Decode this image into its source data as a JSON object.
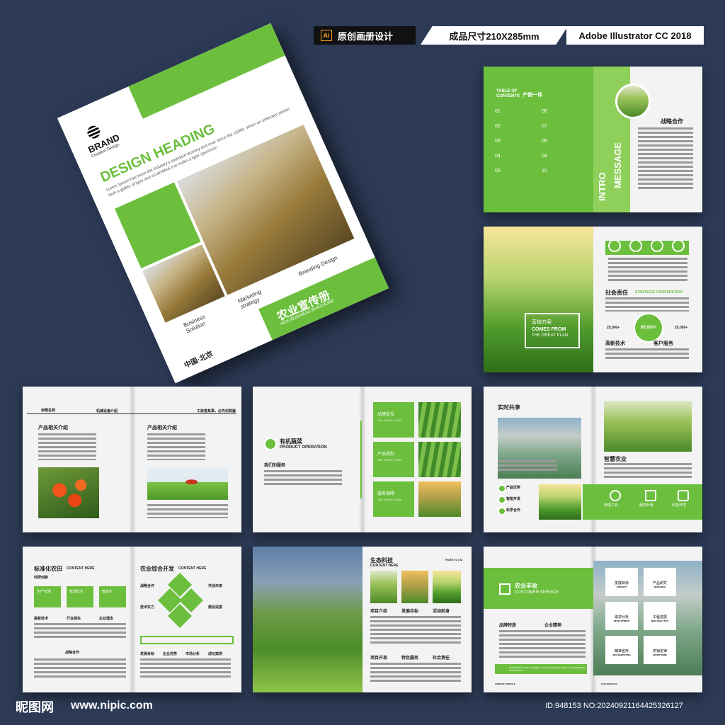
{
  "badges": {
    "ai_glyph": "Ai",
    "left": "原创画册设计",
    "mid": "成品尺寸210X285mm",
    "right": "Adobe Illustrator CC 2018"
  },
  "cover": {
    "brand": "BRAND",
    "brand_sub": "Creative Design",
    "heading": "DESIGN HEADING",
    "lorem": "Lorem Ipsum has been the industry's standard dummy text ever since the 1500s, when an unknown printer took a galley of type and scrambled it to make a type specimen",
    "item1": "Business Solution",
    "item2": "Marketing strategy",
    "item3": "Branding Design",
    "title_cn": "农业宣传册",
    "title_en": "NEW BUSINESS BORCHURE",
    "location": "中国·北京"
  },
  "p1": {
    "toc_a": "TABLE OF",
    "toc_b": "CONTENTS",
    "toc_cn": "产销一体",
    "nums_left": [
      "01",
      "02",
      "03",
      "04",
      "05"
    ],
    "nums_right": [
      "06",
      "07",
      "08",
      "09",
      "10"
    ],
    "intro": "INTRO",
    "message": "MESSAGE",
    "heading_cn": "战略合作"
  },
  "p2": {
    "social": "社会责任",
    "strategic": "STRATEGIC COOPERATION",
    "hl_cn": "营销方案",
    "hl1": "COMES FROM",
    "hl2": "THE GREAT PLAN",
    "stat": "85,000+",
    "stat_side1": "25,000+",
    "stat_side2": "25,000+",
    "lbl1": "高新技术",
    "lbl2": "客户服务"
  },
  "p3": {
    "top_label": "标题名称",
    "top_center": "机械设备介绍",
    "top_right": "工欲善其事，必先利其器",
    "col1": "产品相关介绍",
    "col2": "产品相关介绍"
  },
  "p4": {
    "cn": "有机蔬菜",
    "en": "PRODUCT OPERATION",
    "service": "我们的服务",
    "tab1": "品牌定位",
    "tab2": "产品规划",
    "tab3": "服务保障",
    "tab_sub": "Title of Work | Date"
  },
  "p5": {
    "title": "实时共享",
    "smart": "智慧农业",
    "items": [
      "产品优势",
      "智能开发",
      "科学合作"
    ],
    "icons": [
      "管理工具",
      "服务升级",
      "科技开发"
    ]
  },
  "p6": {
    "left_title": "标准化农田",
    "left_en": "CONTENT HERE",
    "left_sub": "科研创新",
    "bubbles": [
      "生产标准",
      "管理优化",
      "智能化"
    ],
    "mini": [
      "高新技术",
      "行业领先",
      "企业理念"
    ],
    "right_title": "农业综合开发",
    "right_en": "CONTENT HERE",
    "right_items": [
      "战略合作",
      "共创未来",
      "技术实力",
      "建设进度"
    ],
    "bottom": [
      "发展目标",
      "企业优势",
      "市场分析",
      "成功案例"
    ],
    "bottom_left": "战略合作"
  },
  "p7": {
    "title": "生态科技",
    "en": "CONTENT HERE",
    "page": "PAGE 01 | 02",
    "lbl": [
      "项目介绍",
      "发展目标",
      "活动前身",
      "项目开发",
      "特色服务",
      "社会责任"
    ]
  },
  "p8": {
    "cn": "农业丰收",
    "en": "CUSTOMER SERVICE",
    "l1": "品牌特质",
    "l2": "企业精神",
    "boxes": [
      {
        "cn": "发展目标",
        "en": "CONCEPT"
      },
      {
        "cn": "产品研究",
        "en": "RESEARCH"
      },
      {
        "cn": "需求分析",
        "en": "DEVELOPMENT"
      },
      {
        "cn": "工程进展",
        "en": "WEB ANALYTICS"
      },
      {
        "cn": "精准宣传",
        "en": "SEO MARKETING"
      },
      {
        "cn": "供销定律",
        "en": "ADVERTISING"
      }
    ],
    "banner": "RESEARCH IS A KEY ELEMENT TO SUCCESSFUL LAUNCH OF WEB BASED APPLICATION",
    "foot1": "COMPANY PROFILE",
    "foot2": "OUR SERVICES"
  },
  "footer": {
    "brand_cn": "昵图网",
    "url": "www.nipic.com",
    "id": "ID:948153 NO:20240921164425326127"
  }
}
